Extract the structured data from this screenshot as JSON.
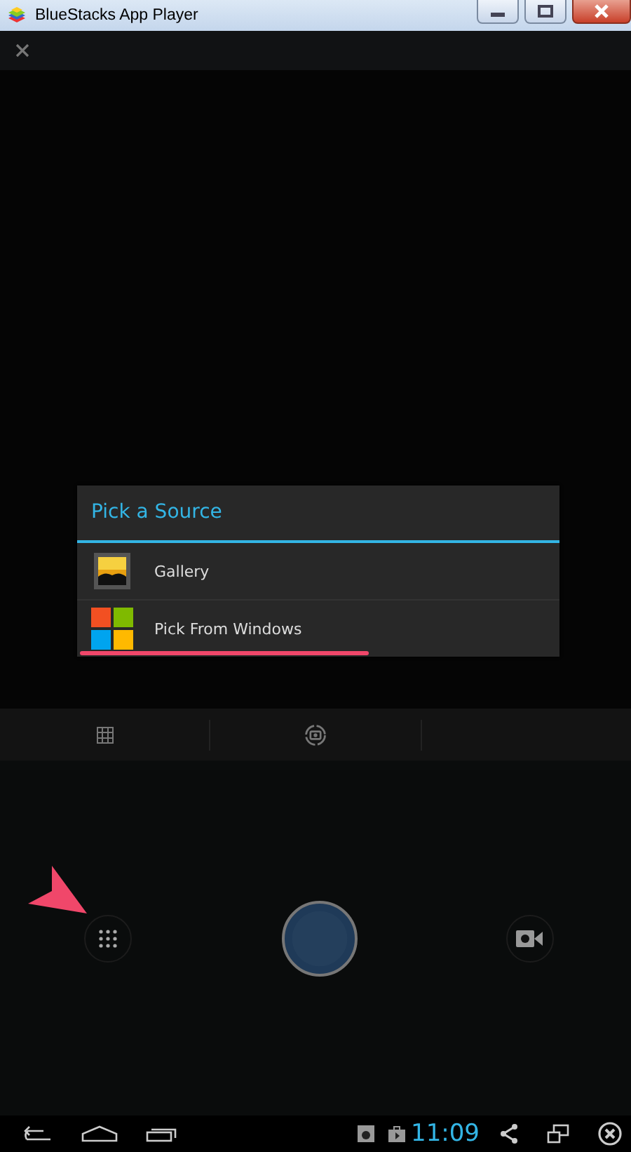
{
  "window": {
    "title": "BlueStacks App Player"
  },
  "dialog": {
    "title": "Pick a Source",
    "items": [
      {
        "label": "Gallery",
        "kind": "gallery",
        "underlined": false
      },
      {
        "label": "Pick From Windows",
        "kind": "windows",
        "underlined": true
      }
    ]
  },
  "status_bar": {
    "clock": "11:09"
  }
}
